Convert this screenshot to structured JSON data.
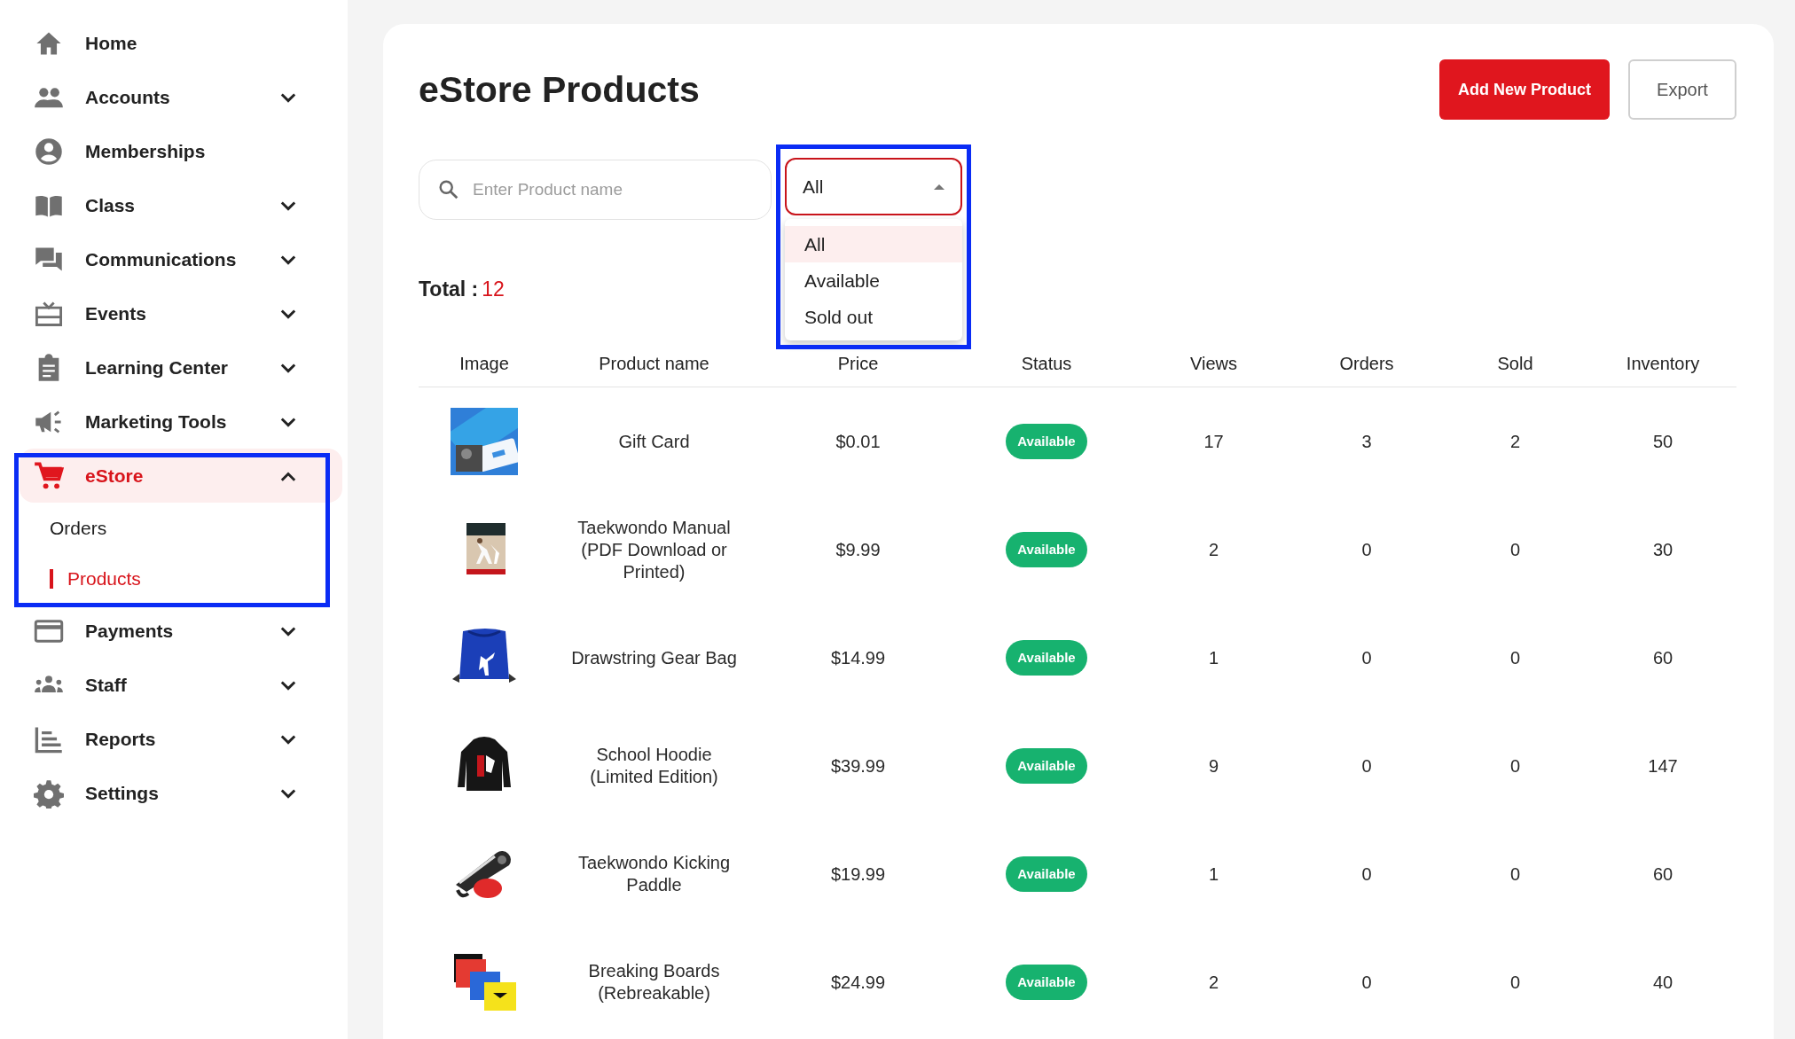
{
  "sidebar": {
    "items": [
      {
        "label": "Home",
        "kind": "link",
        "selected": false
      },
      {
        "label": "Accounts",
        "kind": "group",
        "expanded": false,
        "selected": false
      },
      {
        "label": "Memberships",
        "kind": "link",
        "selected": false
      },
      {
        "label": "Class",
        "kind": "group",
        "expanded": false,
        "selected": false
      },
      {
        "label": "Communications",
        "kind": "group",
        "expanded": false,
        "selected": false
      },
      {
        "label": "Events",
        "kind": "group",
        "expanded": false,
        "selected": false
      },
      {
        "label": "Learning Center",
        "kind": "group",
        "expanded": false,
        "selected": false
      },
      {
        "label": "Marketing Tools",
        "kind": "group",
        "expanded": false,
        "selected": false
      },
      {
        "label": "eStore",
        "kind": "group",
        "expanded": true,
        "selected": true,
        "highlighted": true,
        "children": [
          {
            "label": "Orders",
            "selected": false
          },
          {
            "label": "Products",
            "selected": true
          }
        ]
      },
      {
        "label": "Payments",
        "kind": "group",
        "expanded": false,
        "selected": false
      },
      {
        "label": "Staff",
        "kind": "group",
        "expanded": false,
        "selected": false
      },
      {
        "label": "Reports",
        "kind": "group",
        "expanded": false,
        "selected": false
      },
      {
        "label": "Settings",
        "kind": "group",
        "expanded": false,
        "selected": false
      }
    ]
  },
  "page": {
    "title": "eStore Products",
    "buttons": [
      {
        "label": "Add New Product",
        "kind": "primary"
      },
      {
        "label": "Export",
        "kind": "outline"
      }
    ]
  },
  "search": {
    "placeholder": "Enter Product name"
  },
  "status_filter": {
    "value": "All",
    "open": true,
    "highlighted": true,
    "options": [
      {
        "label": "All",
        "selected": true
      },
      {
        "label": "Available",
        "selected": false
      },
      {
        "label": "Sold out",
        "selected": false
      }
    ]
  },
  "total": {
    "label": "Total :",
    "value": "12"
  },
  "table": {
    "columns": [
      "Image",
      "Product name",
      "Price",
      "Status",
      "Views",
      "Orders",
      "Sold",
      "Inventory"
    ],
    "rows": [
      {
        "name": "Gift Card",
        "price": "$0.01",
        "status": "Available",
        "views": "17",
        "orders": "3",
        "sold": "2",
        "inventory": "50"
      },
      {
        "name": "Taekwondo Manual (PDF Download or Printed)",
        "price": "$9.99",
        "status": "Available",
        "views": "2",
        "orders": "0",
        "sold": "0",
        "inventory": "30"
      },
      {
        "name": "Drawstring Gear Bag",
        "price": "$14.99",
        "status": "Available",
        "views": "1",
        "orders": "0",
        "sold": "0",
        "inventory": "60"
      },
      {
        "name": "School Hoodie (Limited Edition)",
        "price": "$39.99",
        "status": "Available",
        "views": "9",
        "orders": "0",
        "sold": "0",
        "inventory": "147"
      },
      {
        "name": "Taekwondo Kicking Paddle",
        "price": "$19.99",
        "status": "Available",
        "views": "1",
        "orders": "0",
        "sold": "0",
        "inventory": "60"
      },
      {
        "name": "Breaking Boards (Rebreakable)",
        "price": "$24.99",
        "status": "Available",
        "views": "2",
        "orders": "0",
        "sold": "0",
        "inventory": "40"
      }
    ]
  }
}
